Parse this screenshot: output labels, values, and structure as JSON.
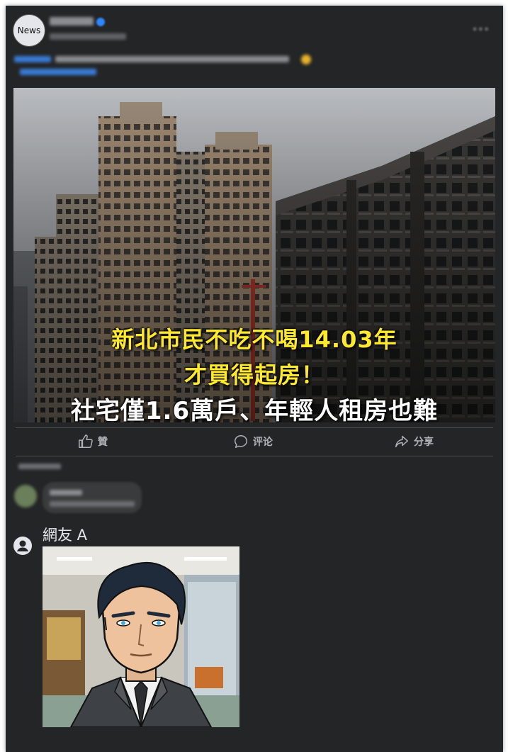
{
  "post": {
    "avatar_label": "News",
    "page_name": "",
    "meta": "",
    "more_icon": "ellipsis-icon"
  },
  "image": {
    "headline_line1": "新北市民不吃不喝14.03年",
    "headline_line2": "才買得起房！",
    "headline_line3": "社宅僅1.6萬戶、年輕人租房也難"
  },
  "actions": {
    "like_label": "贊",
    "comment_label": "评论",
    "share_label": "分享"
  },
  "reply": {
    "username": "網友 A"
  },
  "colors": {
    "card_bg": "#242526",
    "headline_yellow": "#ffe92e",
    "action_text": "#b0b3b8"
  }
}
